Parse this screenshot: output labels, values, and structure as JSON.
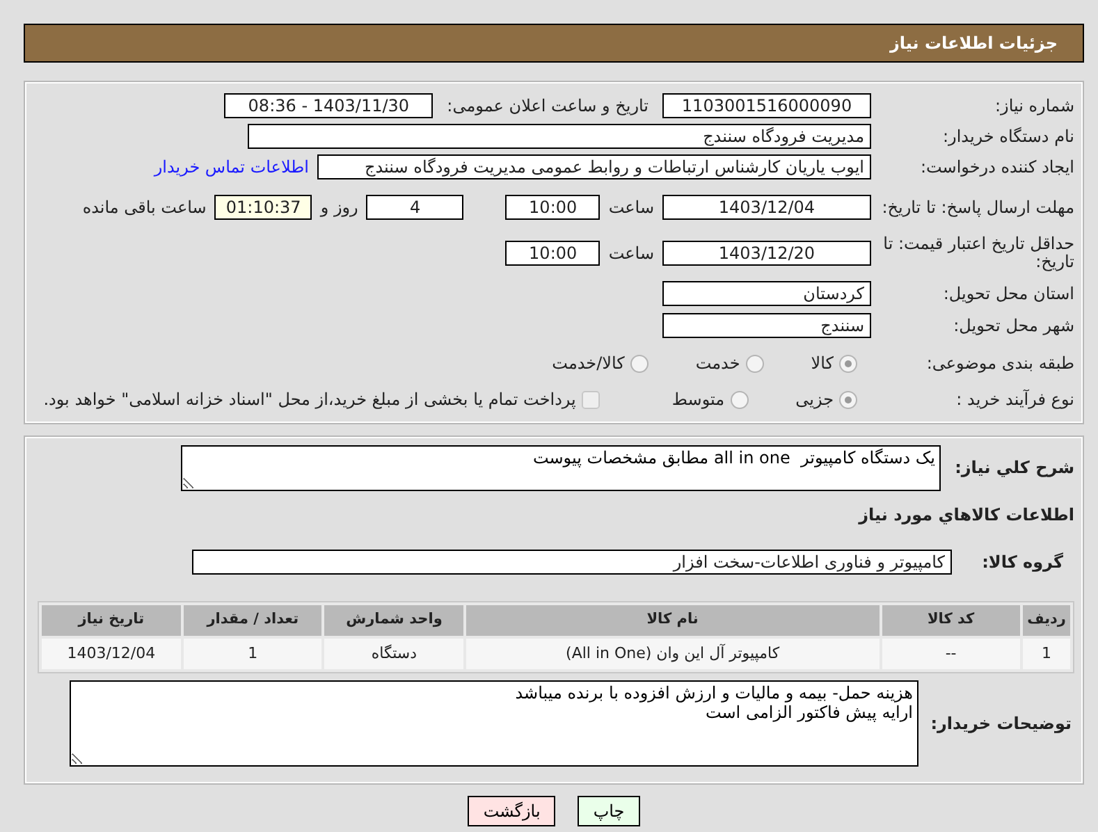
{
  "header": {
    "title": "جزئیات اطلاعات نیاز"
  },
  "need_number": {
    "label": "شماره نیاز:",
    "value": "1103001516000090"
  },
  "announce": {
    "label": "تاریخ و ساعت اعلان عمومی:",
    "value": "1403/11/30 - 08:36"
  },
  "buyer": {
    "label": "نام دستگاه خریدار:",
    "value": "مدیریت فرودگاه سنندج"
  },
  "requester": {
    "label": "ایجاد کننده درخواست:",
    "value": "ایوب یاریان کارشناس ارتباطات و روابط عمومی مدیریت فرودگاه سنندج",
    "link": "اطلاعات تماس خریدار"
  },
  "deadline": {
    "label": "مهلت ارسال پاسخ: تا تاریخ:",
    "date": "1403/12/04",
    "time_label": "ساعت",
    "time": "10:00",
    "days": "4",
    "days_label": "روز و",
    "remaining": "01:10:37",
    "remaining_label": "ساعت باقی مانده"
  },
  "validity": {
    "label": "حداقل تاریخ اعتبار قیمت: تا تاریخ:",
    "date": "1403/12/20",
    "time_label": "ساعت",
    "time": "10:00"
  },
  "province": {
    "label": "استان محل تحویل:",
    "value": "کردستان"
  },
  "city": {
    "label": "شهر محل تحویل:",
    "value": "سنندج"
  },
  "category": {
    "label": "طبقه بندی موضوعی:",
    "options": [
      {
        "label": "کالا",
        "selected": true
      },
      {
        "label": "خدمت",
        "selected": false
      },
      {
        "label": "کالا/خدمت",
        "selected": false
      }
    ]
  },
  "process": {
    "label": "نوع فرآیند خرید :",
    "options": [
      {
        "label": "جزیی",
        "selected": true
      },
      {
        "label": "متوسط",
        "selected": false
      }
    ],
    "payment": {
      "label": "پرداخت تمام یا بخشی از مبلغ خرید،از محل \"اسناد خزانه اسلامی\" خواهد بود.",
      "checked": false
    }
  },
  "description": {
    "label": "شرح کلي نياز:",
    "value": "یک دستگاه کامپیوتر  all in one مطابق مشخصات پیوست"
  },
  "goods_heading": "اطلاعات کالاهاي مورد نياز",
  "goods_group": {
    "label": "گروه کالا:",
    "value": "کامپیوتر و فناوری اطلاعات-سخت افزار"
  },
  "table": {
    "columns": [
      "ردیف",
      "کد کالا",
      "نام کالا",
      "واحد شمارش",
      "تعداد / مقدار",
      "تاریخ نیاز"
    ],
    "rows": [
      [
        "1",
        "--",
        "کامپیوتر آل این وان (All in One)",
        "دستگاه",
        "1",
        "1403/12/04"
      ]
    ]
  },
  "notes": {
    "label": "توضیحات خریدار:",
    "lines": [
      "هزینه حمل- بیمه و مالیات و ارزش افزوده با برنده میباشد",
      "ارایه پیش فاکتور الزامی است"
    ]
  },
  "buttons": [
    {
      "label": "چاپ",
      "kind": "print"
    },
    {
      "label": "بازگشت",
      "kind": "back"
    }
  ]
}
